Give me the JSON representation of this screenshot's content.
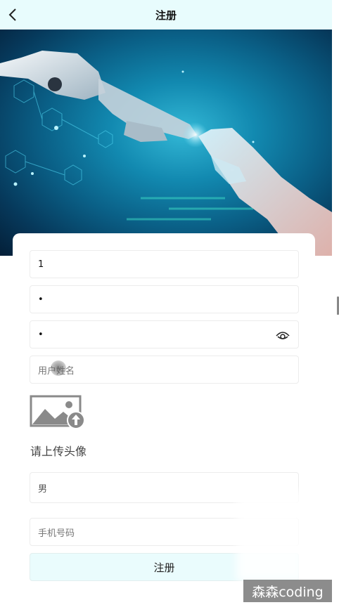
{
  "header": {
    "title": "注册",
    "back_icon": "chevron-left-icon"
  },
  "hero": {
    "image": "robot-and-human-hand-touch-illustration"
  },
  "form": {
    "username": {
      "value": "1"
    },
    "password": {
      "value": "•"
    },
    "confirm_password": {
      "value": "•",
      "toggle_icon": "eye-icon"
    },
    "real_name": {
      "placeholder": "用户姓名"
    },
    "avatar": {
      "icon": "image-upload-icon",
      "hint": "请上传头像"
    },
    "gender": {
      "value": "男"
    },
    "phone": {
      "placeholder": "手机号码"
    },
    "submit_label": "注册"
  },
  "watermark": {
    "text": "森森coding"
  },
  "colors": {
    "header_bg": "#e8fcfd",
    "button_bg": "#eafcfd",
    "hero_primary": "#1289b0"
  }
}
